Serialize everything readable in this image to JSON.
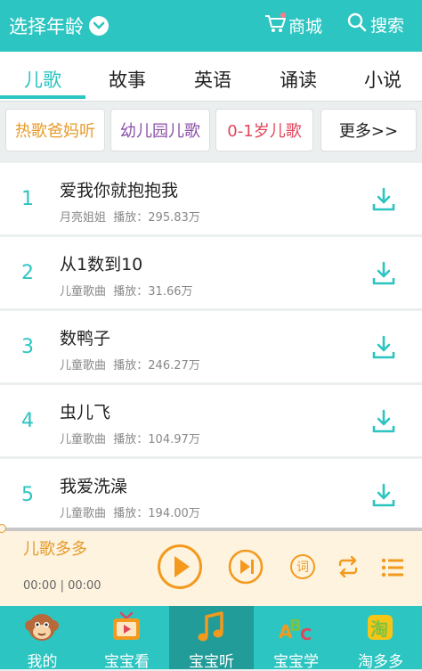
{
  "header": {
    "age_label": "选择年龄",
    "shop_label": "商城",
    "search_label": "搜索",
    "accent": "#2cc5c1"
  },
  "tabs": [
    {
      "label": "儿歌"
    },
    {
      "label": "故事"
    },
    {
      "label": "英语"
    },
    {
      "label": "诵读"
    },
    {
      "label": "小说"
    }
  ],
  "chips": [
    {
      "label": "热歌爸妈听",
      "color": "#e69a2a"
    },
    {
      "label": "幼儿园儿歌",
      "color": "#8b4fa8"
    },
    {
      "label": "0-1岁儿歌",
      "color": "#e2455a"
    },
    {
      "label": "更多>>",
      "color": "#222222"
    }
  ],
  "songs": [
    {
      "num": "1",
      "title": "爱我你就抱抱我",
      "artist": "月亮姐姐",
      "plays": "播放：295.83万"
    },
    {
      "num": "2",
      "title": "从1数到10",
      "artist": "儿童歌曲",
      "plays": "播放：31.66万"
    },
    {
      "num": "3",
      "title": "数鸭子",
      "artist": "儿童歌曲",
      "plays": "播放：246.27万"
    },
    {
      "num": "4",
      "title": "虫儿飞",
      "artist": "儿童歌曲",
      "plays": "播放：104.97万"
    },
    {
      "num": "5",
      "title": "我爱洗澡",
      "artist": "儿童歌曲",
      "plays": "播放：194.00万"
    }
  ],
  "player": {
    "title": "儿歌多多",
    "time": "00:00 | 00:00",
    "lyrics_glyph": "词",
    "progress": 0
  },
  "bottom_nav": [
    {
      "label": "我的",
      "icon": "monkey-icon"
    },
    {
      "label": "宝宝看",
      "icon": "tv-icon"
    },
    {
      "label": "宝宝听",
      "icon": "music-note-icon"
    },
    {
      "label": "宝宝学",
      "icon": "abc-icon"
    },
    {
      "label": "淘多多",
      "icon": "tao-icon"
    }
  ]
}
